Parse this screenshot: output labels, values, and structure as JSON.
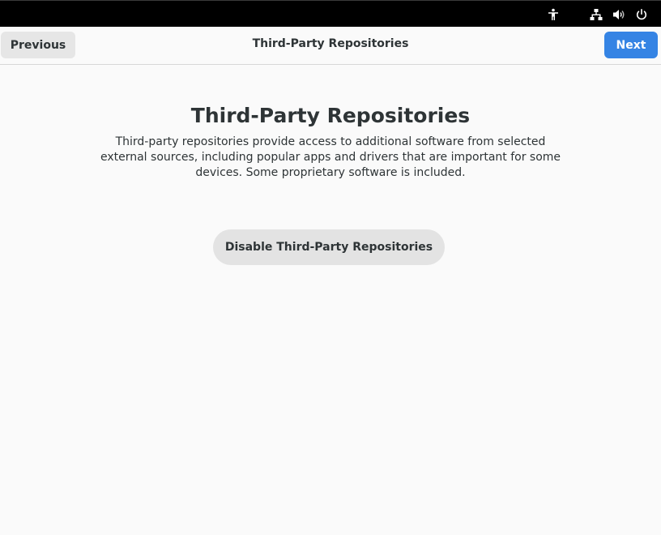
{
  "top_bar": {
    "icons": [
      "accessibility-icon",
      "network-wired-icon",
      "volume-icon",
      "power-icon"
    ]
  },
  "header": {
    "previous_label": "Previous",
    "title": "Third-Party Repositories",
    "next_label": "Next"
  },
  "content": {
    "title": "Third-Party Repositories",
    "description": "Third-party repositories provide access to additional software from selected external sources, including popular apps and drivers that are important for some devices. Some proprietary software is included.",
    "disable_button_label": "Disable Third-Party Repositories"
  },
  "colors": {
    "accent": "#3584e4",
    "top_bar": "#000000",
    "background": "#fafafa",
    "secondary_button": "#e3e3e3"
  }
}
